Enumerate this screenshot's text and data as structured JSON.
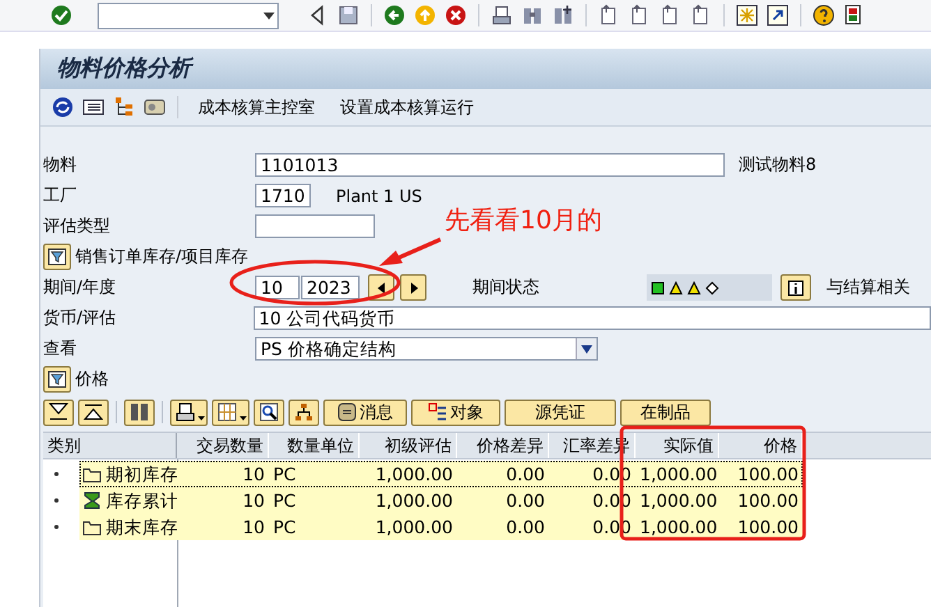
{
  "title": "物料价格分析",
  "app_toolbar": {
    "buttons": [
      "成本核算主控室",
      "设置成本核算运行"
    ]
  },
  "material": {
    "label": "物料",
    "value": "1101013",
    "description": "测试物料8"
  },
  "plant": {
    "label": "工厂",
    "value": "1710",
    "description": "Plant 1 US"
  },
  "valuation_type": {
    "label": "评估类型"
  },
  "sales_order_toggle": {
    "label": "销售订单库存/项目库存"
  },
  "period": {
    "label": "期间/年度",
    "period": "10",
    "year": "2023",
    "status_label": "期间状态",
    "info_label": "与结算相关"
  },
  "currency": {
    "label": "货币/评估",
    "value": "10 公司代码货币"
  },
  "view": {
    "label": "查看",
    "value": "PS 价格确定结构"
  },
  "price_toggle": {
    "label": "价格"
  },
  "grid_toolbar": {
    "buttons": [
      "消息",
      "对象",
      "源凭证",
      "在制品"
    ]
  },
  "table": {
    "columns": [
      "类别",
      "交易数量",
      "数量单位",
      "初级评估",
      "价格差异",
      "汇率差异",
      "实际值",
      "价格"
    ],
    "rows": [
      {
        "kind": "folder",
        "selected": true,
        "cells": [
          "期初库存",
          "10",
          "PC",
          "1,000.00",
          "0.00",
          "0.00",
          "1,000.00",
          "100.00"
        ]
      },
      {
        "kind": "sum",
        "selected": false,
        "cells": [
          "库存累计",
          "10",
          "PC",
          "1,000.00",
          "0.00",
          "0.00",
          "1,000.00",
          "100.00"
        ]
      },
      {
        "kind": "folder",
        "selected": false,
        "cells": [
          "期末库存",
          "10",
          "PC",
          "1,000.00",
          "0.00",
          "0.00",
          "1,000.00",
          "100.00"
        ]
      }
    ]
  },
  "annotation": {
    "callout": "先看看10月的"
  }
}
